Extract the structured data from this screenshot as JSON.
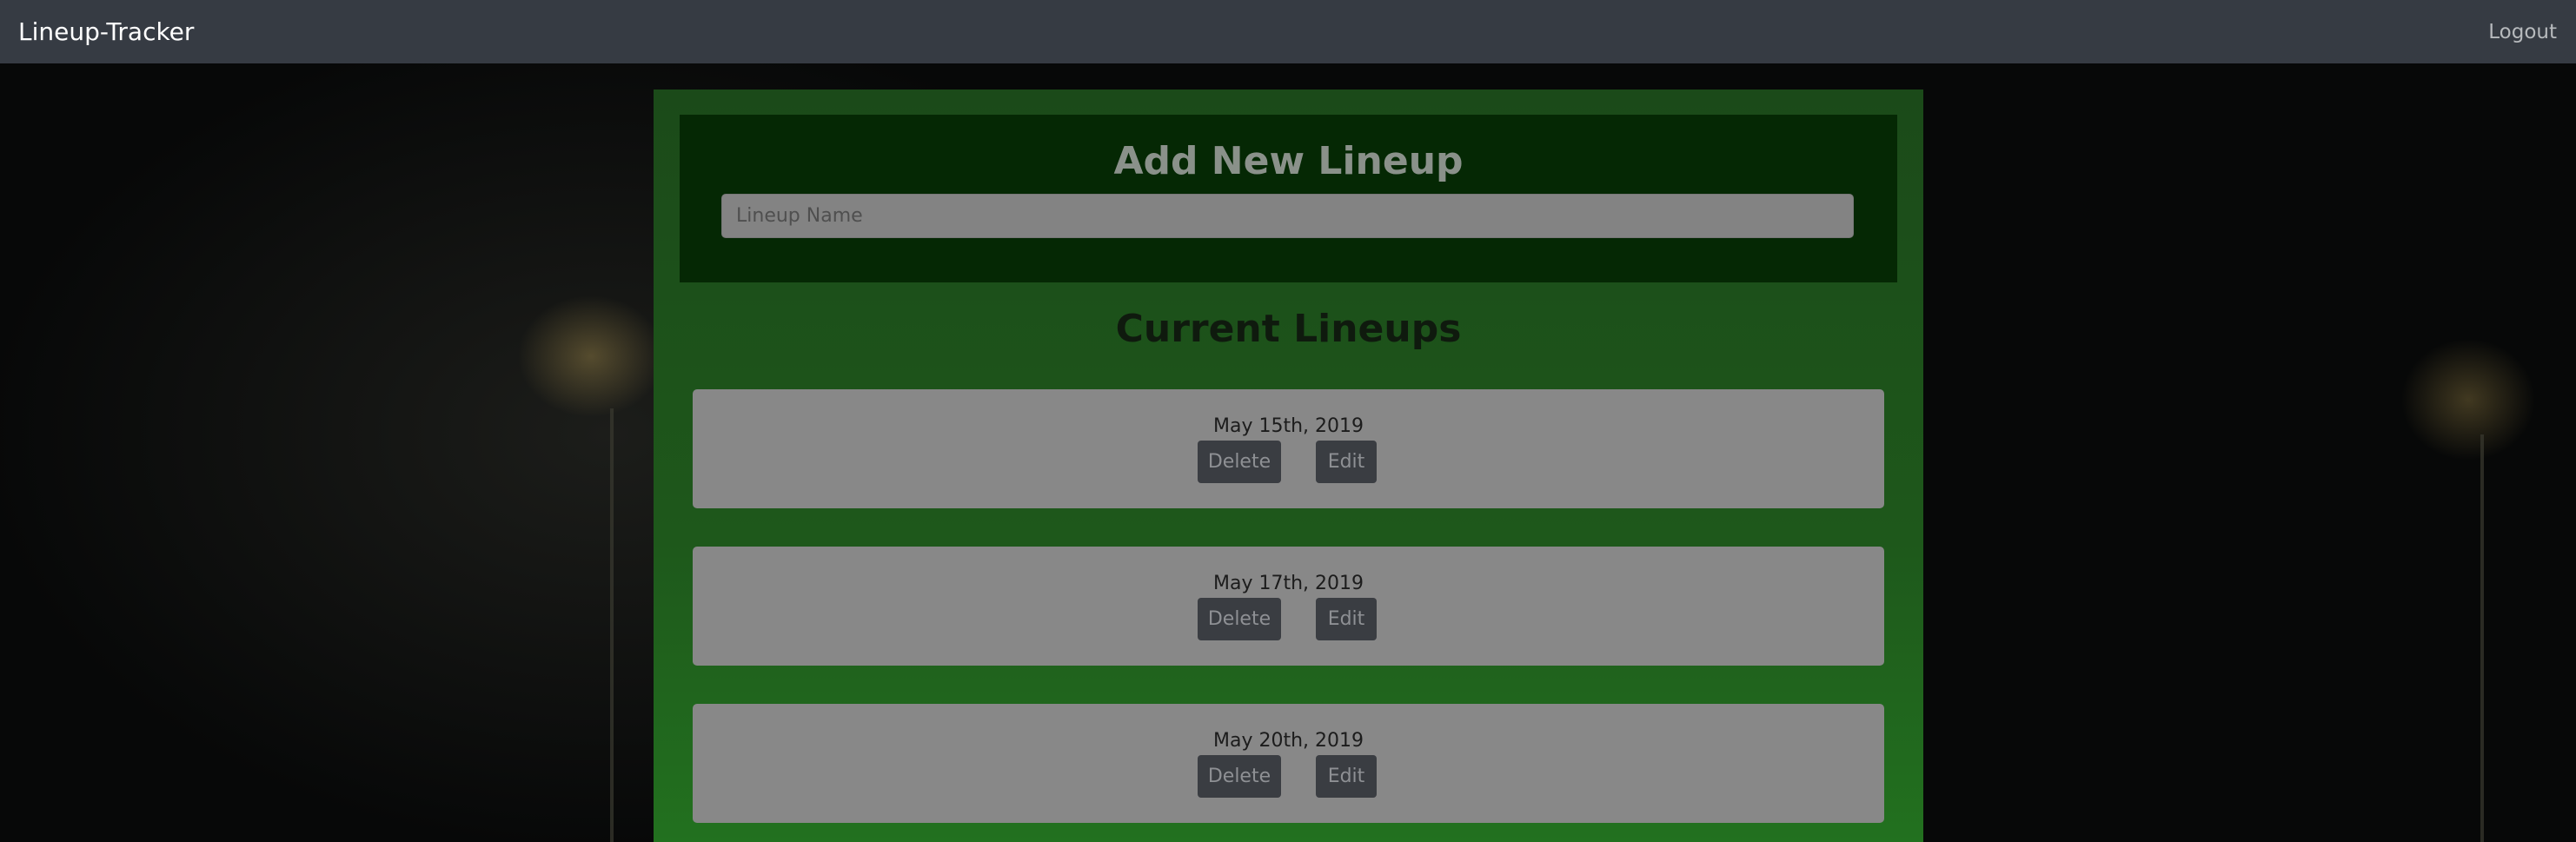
{
  "navbar": {
    "brand": "Lineup-Tracker",
    "logout_label": "Logout"
  },
  "add_lineup": {
    "title": "Add New Lineup",
    "input_placeholder": "Lineup Name",
    "input_value": ""
  },
  "current_lineups": {
    "title": "Current Lineups",
    "items": [
      {
        "date": "May 15th, 2019",
        "delete_label": "Delete",
        "edit_label": "Edit"
      },
      {
        "date": "May 17th, 2019",
        "delete_label": "Delete",
        "edit_label": "Edit"
      },
      {
        "date": "May 20th, 2019",
        "delete_label": "Delete",
        "edit_label": "Edit"
      }
    ]
  },
  "colors": {
    "navbar": "#363b43",
    "panel_green": "#1e581b",
    "card_gray": "#888888"
  }
}
